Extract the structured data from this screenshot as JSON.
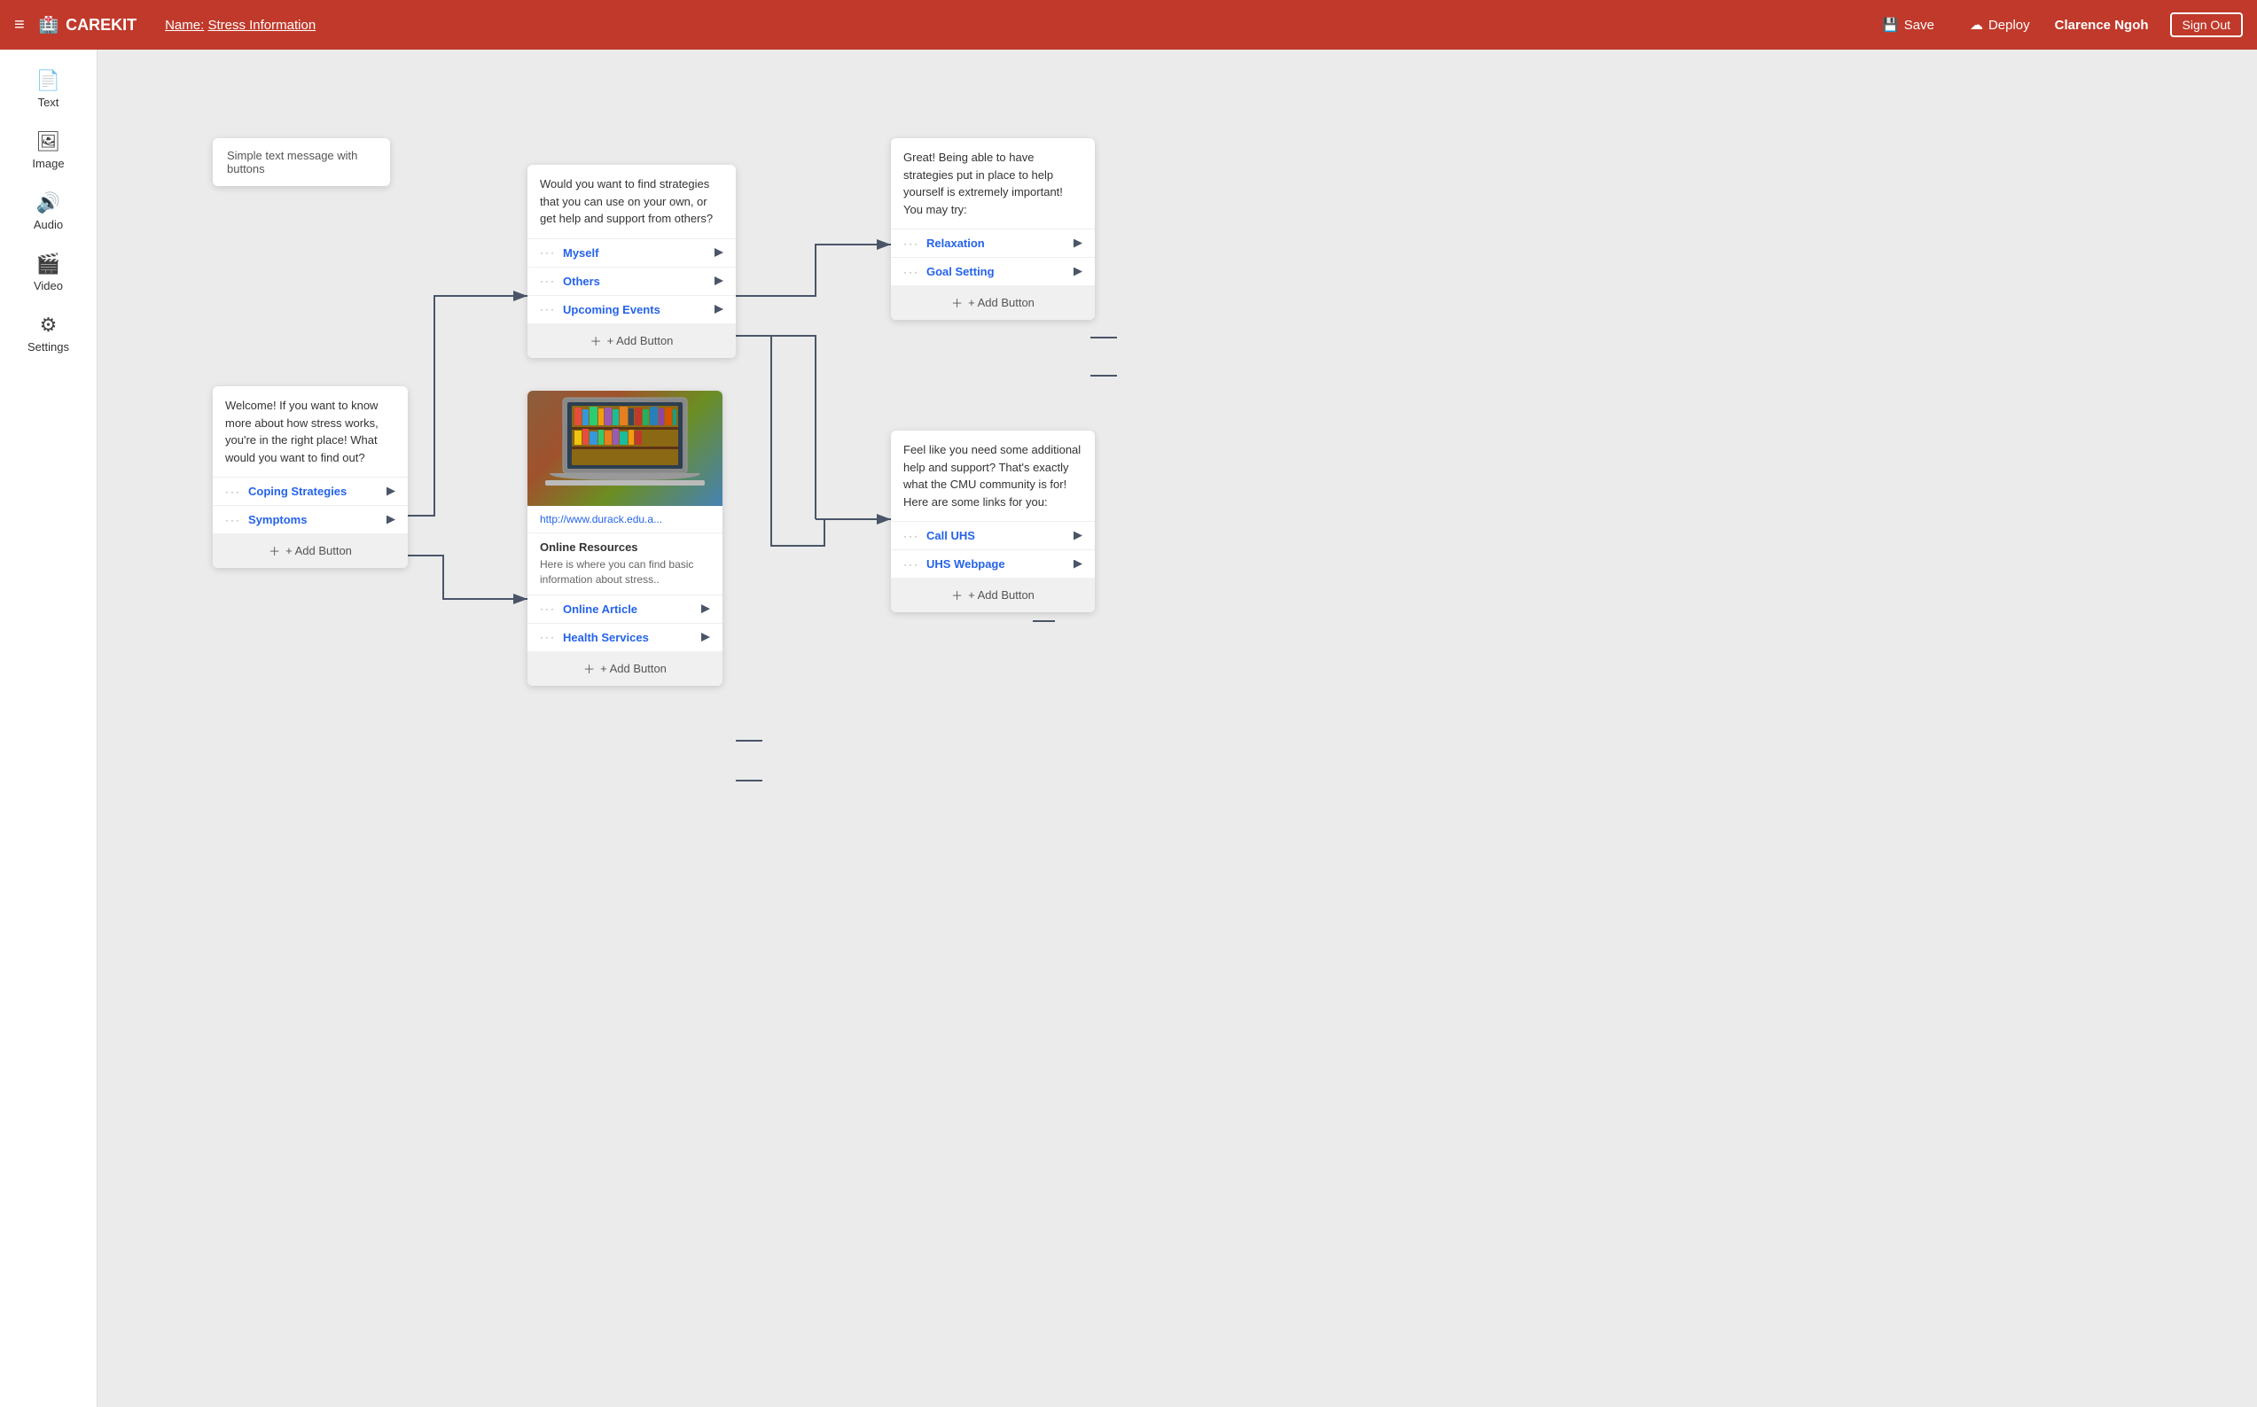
{
  "header": {
    "menu_icon": "≡",
    "logo_icon": "🏥",
    "logo_text": "CAREKIT",
    "name_label": "Name:",
    "name_value": "Stress Information",
    "save_icon": "💾",
    "save_label": "Save",
    "deploy_icon": "☁",
    "deploy_label": "Deploy",
    "user_name": "Clarence Ngoh",
    "signout_label": "Sign Out"
  },
  "sidebar": {
    "items": [
      {
        "id": "text",
        "icon": "📄",
        "label": "Text"
      },
      {
        "id": "image",
        "icon": "🖼",
        "label": "Image"
      },
      {
        "id": "audio",
        "icon": "🔊",
        "label": "Audio"
      },
      {
        "id": "video",
        "icon": "🎬",
        "label": "Video"
      },
      {
        "id": "settings",
        "icon": "⚙",
        "label": "Settings"
      }
    ]
  },
  "canvas": {
    "simple_message": "Simple text message with buttons",
    "cards": {
      "welcome": {
        "text": "Welcome! If you want to know more about how stress works, you're in the right place! What would you want to find out?",
        "buttons": [
          {
            "label": "Coping Strategies"
          },
          {
            "label": "Symptoms"
          }
        ],
        "add_button": "+ Add Button"
      },
      "strategies": {
        "text": "Would you want to find strategies that you can use on your own, or get help and support from others?",
        "buttons": [
          {
            "label": "Myself"
          },
          {
            "label": "Others"
          },
          {
            "label": "Upcoming Events"
          }
        ],
        "add_button": "+ Add Button"
      },
      "great": {
        "text": "Great! Being able to have strategies put in place to help yourself is extremely important! You may try:",
        "buttons": [
          {
            "label": "Relaxation"
          },
          {
            "label": "Goal Setting"
          }
        ],
        "add_button": "+ Add Button"
      },
      "support": {
        "text": "Feel like you need some additional help and support? That's exactly what the CMU community is for! Here are some links for you:",
        "buttons": [
          {
            "label": "Call UHS"
          },
          {
            "label": "UHS Webpage"
          }
        ],
        "add_button": "+ Add Button"
      },
      "resources": {
        "image_url": "",
        "link": "http://www.durack.edu.a...",
        "title": "Online Resources",
        "description": "Here is where you can find basic information about stress..",
        "buttons": [
          {
            "label": "Online Article"
          },
          {
            "label": "Health Services"
          }
        ],
        "add_button": "+ Add Button"
      }
    }
  }
}
